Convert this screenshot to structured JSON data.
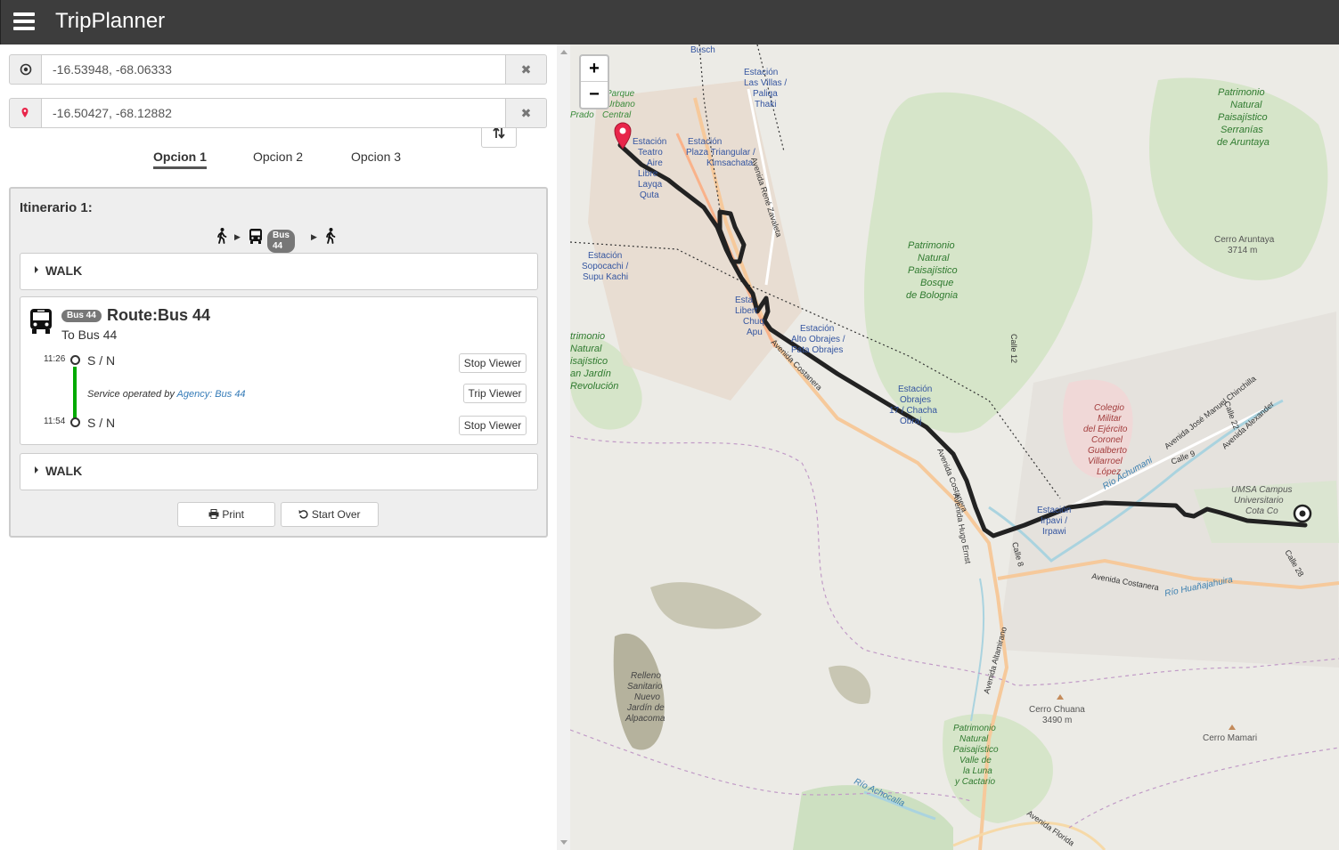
{
  "app": {
    "title": "TripPlanner"
  },
  "origin": {
    "value": "-16.53948, -68.06333",
    "clear": "✖"
  },
  "destination": {
    "value": "-16.50427, -68.12882",
    "clear": "✖"
  },
  "tabs": [
    {
      "label": "Opcion 1"
    },
    {
      "label": "Opcion 2"
    },
    {
      "label": "Opcion 3"
    }
  ],
  "itinerary": {
    "title": "Itinerario 1:",
    "summary": {
      "badge": "Bus 44",
      "sep": "▶"
    },
    "walk1": "WALK",
    "bus": {
      "badge": "Bus 44",
      "route": "Route:Bus 44",
      "dest": "To Bus 44",
      "from_time": "11:26",
      "from_stop": "S / N",
      "to_time": "11:54",
      "to_stop": "S / N",
      "service_prefix": "Service operated by",
      "agency": "Agency: Bus 44",
      "stop_viewer": "Stop Viewer",
      "trip_viewer": "Trip Viewer"
    },
    "walk2": "WALK",
    "print": "Print",
    "start_over": "Start Over"
  },
  "map": {
    "zoom_in": "+",
    "zoom_out": "−",
    "labels": {
      "busch": "Busch",
      "parque": "Parque",
      "urbano": "Urbano",
      "prado": "Prado",
      "central": "Central",
      "las_villas_1": "Estación",
      "las_villas_2": "Las Villas /",
      "las_villas_3": "Paliqa",
      "las_villas_4": "Thaki",
      "teatro_1": "Estación",
      "teatro_2": "Teatro",
      "teatro_3": "Aire",
      "teatro_4": "Libre",
      "teatro_5": "Layqa",
      "teatro_6": "Quta",
      "plaza_1": "Estación",
      "plaza_2": "Plaza Triangular /",
      "plaza_3": "Kimsachata",
      "rene": "Avenida René Zavaleta",
      "serranias_1": "Patrimonio",
      "serranias_2": "Natural",
      "serranias_3": "Paisajístico",
      "serranias_4": "Serranías",
      "serranias_5": "de Aruntaya",
      "bolognia_1": "Patrimonio",
      "bolognia_2": "Natural",
      "bolognia_3": "Paisajístico",
      "bolognia_4": "Bosque",
      "bolognia_5": "de Bolognia",
      "cerro_aruntaya_1": "Cerro Aruntaya",
      "cerro_aruntaya_2": "3714 m",
      "sopocachi_1": "Estación",
      "sopocachi_2": "Sopocachi /",
      "sopocachi_3": "Supu Kachi",
      "libertador_1": "Esta",
      "libertador_2": "Libert",
      "libertador_3": "Chuq",
      "libertador_4": "Apu",
      "alto_obrajes_1": "Estación",
      "alto_obrajes_2": "Alto Obrajes /",
      "alto_obrajes_3": "Pata Obrajes",
      "calle12": "Calle 12",
      "revolucion_1": "trimonio",
      "revolucion_2": "Natural",
      "revolucion_3": "isajístico",
      "revolucion_4": "an Jardín",
      "revolucion_5": "Revolución",
      "costanera1": "Avenida Costanera",
      "obrajes_1": "Estación",
      "obrajes_2": "Obrajes",
      "obrajes_3": "17 / Chacha",
      "obrajes_4": "Obraj",
      "colegio_1": "Colegio",
      "colegio_2": "Militar",
      "colegio_3": "del Ejército",
      "colegio_4": "Coronel",
      "colegio_5": "Gualberto",
      "colegio_6": "Villarroel",
      "colegio_7": "López",
      "chinchilla": "Avenida José Manuel Chinchilla",
      "calle22": "Calle 22",
      "alexander": "Avenida Alexander",
      "achumani": "Río Achumani",
      "calle9": "Calle 9",
      "umsa_1": "UMSA Campus",
      "umsa_2": "Universitario",
      "umsa_3": "Cota Co",
      "costanera2": "Avenida Costanera",
      "irpavi_1": "Estación",
      "irpavi_2": "Irpavi /",
      "irpawi": "Irpawi",
      "hugo_ernst": "Avenida Hugo Ernst",
      "calle8": "Calle 8",
      "calle28": "Calle 28",
      "costanera3": "Avenida Costanera",
      "huanajahuira": "Río Huañajahuira",
      "altamirano": "Avenida Altamirano",
      "relleno_1": "Relleno",
      "relleno_2": "Sanitario",
      "relleno_3": "Nuevo",
      "relleno_4": "Jardín de",
      "relleno_5": "Alpacoma",
      "chuana_1": "Cerro Chuana",
      "chuana_2": "3490 m",
      "mamari": "Cerro Mamari",
      "luna_1": "Patrimonio",
      "luna_2": "Natural",
      "luna_3": "Paisajístico",
      "luna_4": "Valle de",
      "luna_5": "la Luna",
      "luna_6": "y Cactario",
      "achocalla": "Río Achocalla",
      "florida": "Avenida Florida"
    }
  }
}
